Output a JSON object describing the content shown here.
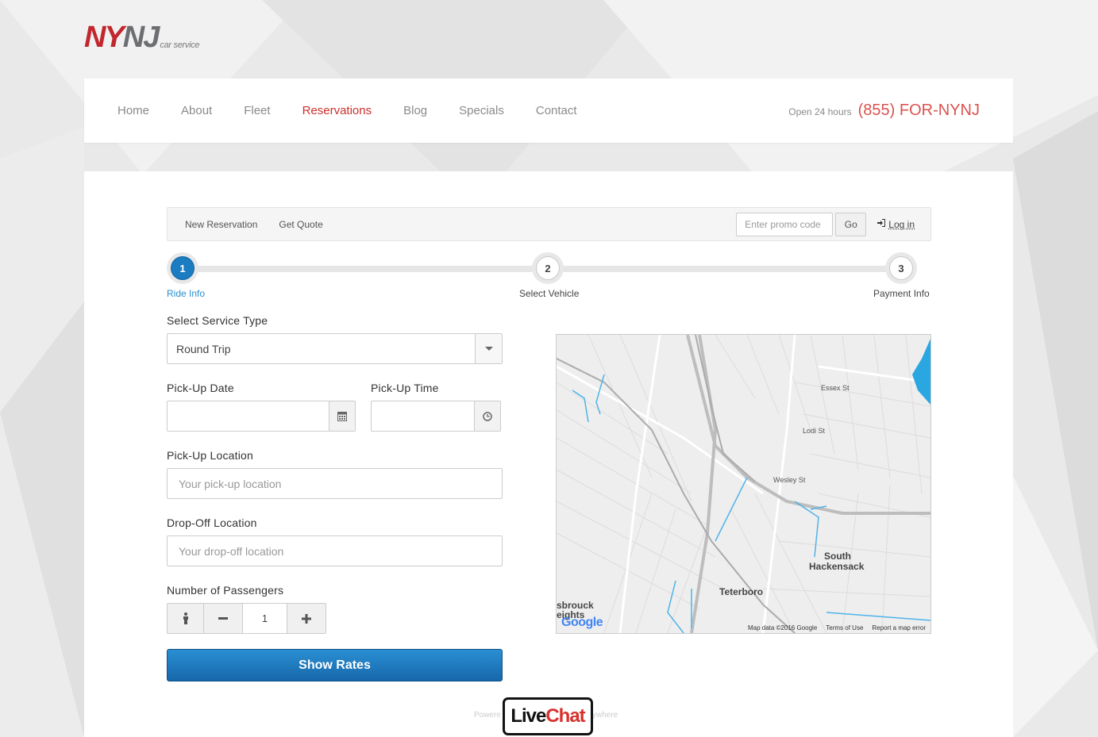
{
  "brand": {
    "logo_ny": "NY",
    "logo_nj": "NJ",
    "logo_sub": "car service"
  },
  "nav": {
    "items": [
      {
        "label": "Home"
      },
      {
        "label": "About"
      },
      {
        "label": "Fleet"
      },
      {
        "label": "Reservations",
        "active": true
      },
      {
        "label": "Blog"
      },
      {
        "label": "Specials"
      },
      {
        "label": "Contact"
      }
    ],
    "open_hours": "Open 24 hours",
    "phone": "(855) FOR-NYNJ"
  },
  "subbar": {
    "new_reservation": "New Reservation",
    "get_quote": "Get Quote",
    "promo_placeholder": "Enter promo code",
    "go_label": "Go",
    "login_label": "Log in"
  },
  "steps": [
    {
      "number": "1",
      "label": "Ride Info",
      "active": true
    },
    {
      "number": "2",
      "label": "Select Vehicle"
    },
    {
      "number": "3",
      "label": "Payment Info"
    }
  ],
  "form": {
    "service_type_label": "Select Service Type",
    "service_type_value": "Round Trip",
    "pickup_date_label": "Pick-Up Date",
    "pickup_time_label": "Pick-Up Time",
    "pickup_location_label": "Pick-Up Location",
    "pickup_location_placeholder": "Your pick-up location",
    "dropoff_location_label": "Drop-Off Location",
    "dropoff_location_placeholder": "Your drop-off location",
    "passengers_label": "Number of Passengers",
    "passengers_value": "1",
    "show_rates_label": "Show Rates"
  },
  "map": {
    "labels": {
      "essex": "Essex St",
      "lodi": "Lodi St",
      "wesley": "Wesley St",
      "south_hackensack_1": "South",
      "south_hackensack_2": "Hackensack",
      "teterboro": "Teterboro",
      "ebrouck_1": "sbrouck",
      "ebrouck_2": "eights"
    },
    "google_logo": "Google",
    "map_data": "Map data ©2016 Google",
    "terms": "Terms of Use",
    "report": "Report a map error"
  },
  "livechat": {
    "powered_left": "Powere",
    "powered_right": "ywhere",
    "live": "Live",
    "chat": "Chat"
  },
  "colors": {
    "accent_red": "#d9534f",
    "primary_blue": "#1b7cc1"
  }
}
